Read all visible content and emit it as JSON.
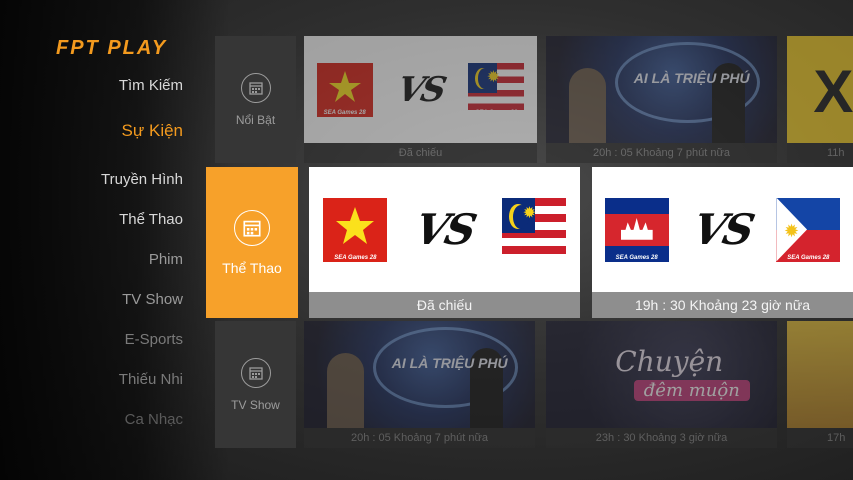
{
  "app": {
    "logo_text": "FPT PLAY",
    "accent_color": "#f39a1e",
    "selected_tile_color": "#f7a12a"
  },
  "sidebar": {
    "items": [
      {
        "label": "Tìm Kiếm"
      },
      {
        "label": "Sự Kiện",
        "active": true
      },
      {
        "label": "Truyền Hình"
      },
      {
        "label": "Thể Thao"
      },
      {
        "label": "Phim"
      },
      {
        "label": "TV Show"
      },
      {
        "label": "E-Sports"
      },
      {
        "label": "Thiếu Nhi"
      },
      {
        "label": "Ca Nhạc"
      }
    ]
  },
  "categories": [
    {
      "label": "Nổi Bật",
      "icon": "calendar-icon"
    },
    {
      "label": "Thể Thao",
      "icon": "calendar-icon",
      "selected": true
    },
    {
      "label": "TV Show",
      "icon": "calendar-icon"
    }
  ],
  "rows": {
    "top": {
      "cards": [
        {
          "caption": "Đã chiếu",
          "badge": "SEA Games 28"
        },
        {
          "caption": "20h : 05  Khoảng 7 phút nữa",
          "show_title": "AI LÀ TRIỆU PHÚ"
        },
        {
          "caption": "11h"
        }
      ]
    },
    "middle": {
      "cards": [
        {
          "caption": "Đã chiếu",
          "vs": "VS",
          "badge": "SEA Games 28"
        },
        {
          "caption": "19h : 30  Khoảng 23 giờ nữa",
          "vs": "VS",
          "badge": "SEA Games 28"
        }
      ]
    },
    "bottom": {
      "cards": [
        {
          "caption": "20h : 05  Khoảng 7 phút nữa",
          "show_title": "AI LÀ TRIỆU PHÚ"
        },
        {
          "caption": "23h : 30  Khoảng 3 giờ nữa",
          "title_line1": "Chuyện",
          "title_line2": "đêm muộn"
        },
        {
          "caption": "17h"
        }
      ]
    }
  }
}
